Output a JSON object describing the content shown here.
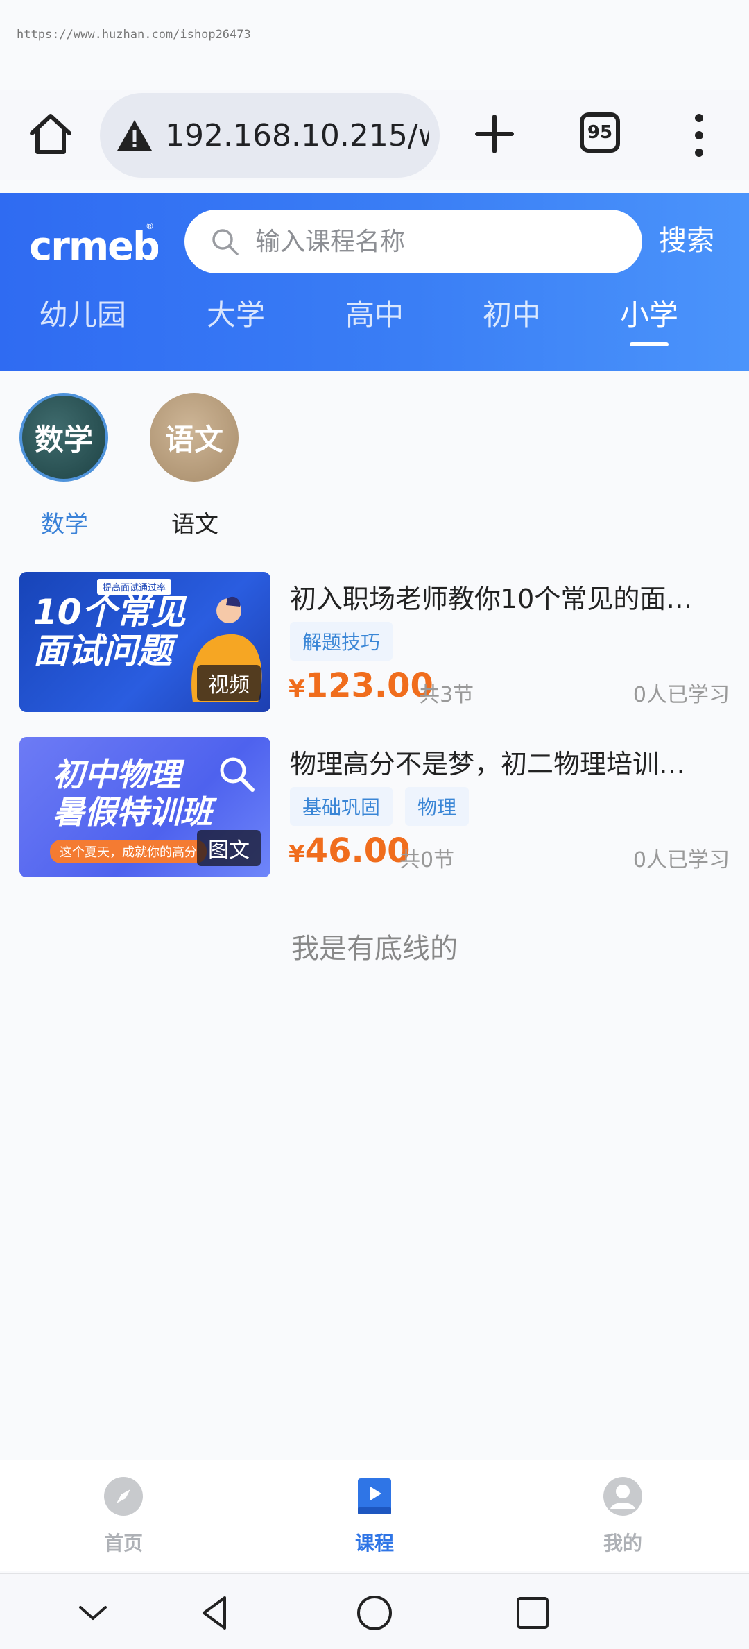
{
  "watermark": "https://www.huzhan.com/ishop26473",
  "browser": {
    "url": "192.168.10.215/w",
    "tab_count": "95"
  },
  "header": {
    "logo_text": "crmeb",
    "search_placeholder": "输入课程名称",
    "search_button": "搜索"
  },
  "level_tabs": [
    {
      "label": "幼儿园",
      "active": false
    },
    {
      "label": "大学",
      "active": false
    },
    {
      "label": "高中",
      "active": false
    },
    {
      "label": "初中",
      "active": false
    },
    {
      "label": "小学",
      "active": true
    }
  ],
  "subjects": [
    {
      "icon_text": "数学",
      "label": "数学",
      "active": true
    },
    {
      "icon_text": "语文",
      "label": "语文",
      "active": false
    }
  ],
  "courses": [
    {
      "thumb_line1": "10个常见",
      "thumb_line2": "面试问题",
      "thumb_caption": "提高面试通过率",
      "badge": "视频",
      "title": "初入职场老师教你10个常见的面…",
      "tags": [
        "解题技巧"
      ],
      "currency": "¥",
      "price": "123.00",
      "lessons": "共3节",
      "learners": "0人已学习"
    },
    {
      "thumb_line1": "初中物理",
      "thumb_line2": "暑假特训班",
      "thumb_caption": "这个夏天，成就你的高分",
      "badge": "图文",
      "title": "物理高分不是梦，初二物理培训…",
      "tags": [
        "基础巩固",
        "物理"
      ],
      "currency": "¥",
      "price": "46.00",
      "lessons": "共0节",
      "learners": "0人已学习"
    }
  ],
  "end_text": "我是有底线的",
  "tabbar": [
    {
      "label": "首页",
      "icon": "compass-icon",
      "active": false
    },
    {
      "label": "课程",
      "icon": "book-play-icon",
      "active": true
    },
    {
      "label": "我的",
      "icon": "user-icon",
      "active": false
    }
  ],
  "colors": {
    "brand_blue": "#2f6bf2",
    "price_orange": "#f06d1d",
    "tag_blue": "#3a86d6"
  }
}
